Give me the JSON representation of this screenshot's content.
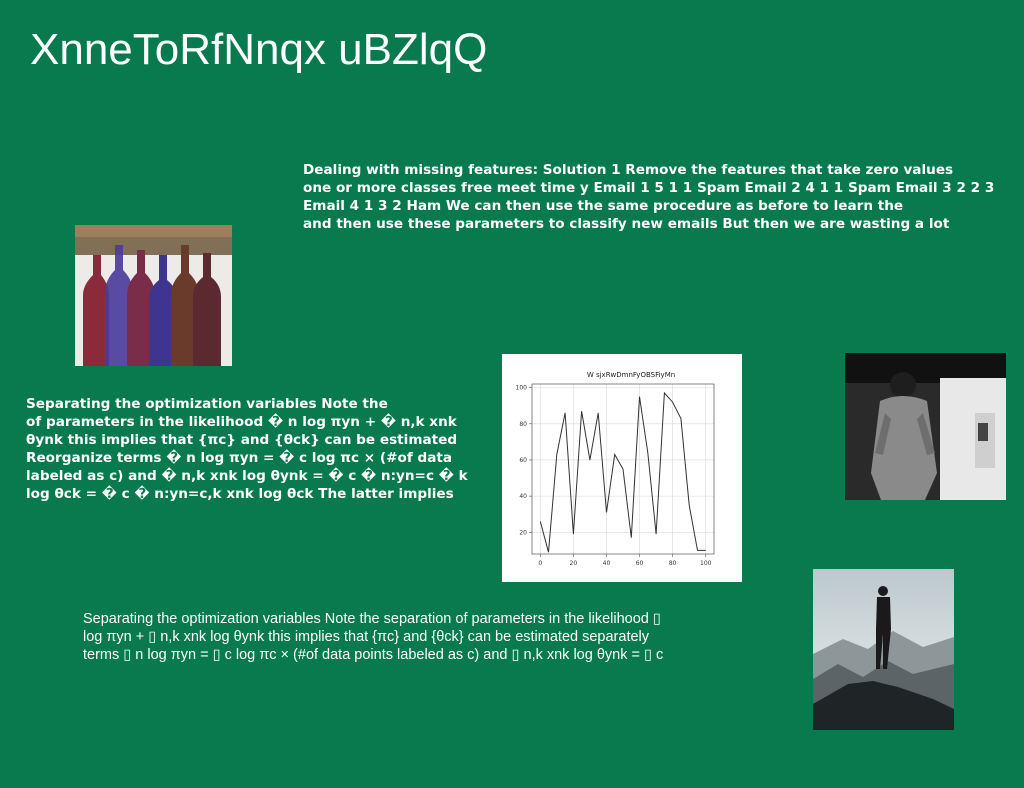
{
  "slide": {
    "title": "XnneToRfNnqx uBZlqQ",
    "text_block_1": [
      "Dealing with missing features: Solution 1 Remove the features that take zero values",
      "one or more classes free meet time y Email 1 5 1 1 Spam Email 2 4 1 1 Spam Email 3 2 2 3",
      "Email 4 1 3 2 Ham We can then use the same procedure as before to learn the",
      "and then use these parameters to classify new emails But then we are wasting a lot"
    ],
    "text_block_2": [
      "Separating the optimization variables Note the",
      "of parameters in the likelihood � n log πyn + � n,k xnk",
      "θynk this implies that {πc} and {θck} can be estimated",
      "Reorganize terms � n log πyn = � c log πc × (#of data",
      "labeled as c) and � n,k xnk log θynk = � c � n:yn=c � k",
      "log θck = � c � n:yn=c,k xnk log θck The latter implies"
    ],
    "text_block_3": [
      "Separating the optimization variables Note the separation of parameters in the likelihood ▯",
      "log πyn + ▯ n,k xnk log θynk this implies that {πc} and {θck} can be estimated separately",
      "terms ▯ n log πyn = ▯ c log πc × (#of data points labeled as c) and ▯ n,k xnk log θynk = ▯ c"
    ]
  },
  "colors": {
    "background": "#087a4e",
    "text": "#ffffff"
  },
  "chart_data": {
    "type": "line",
    "title": "W sjxRwDmnFyOBSFiyMn",
    "xlabel": "",
    "ylabel": "",
    "xlim": [
      -5,
      105
    ],
    "ylim": [
      8,
      102
    ],
    "x_ticks": [
      0,
      20,
      40,
      60,
      80,
      100
    ],
    "y_ticks": [
      20,
      40,
      60,
      80,
      100
    ],
    "grid": true,
    "series": [
      {
        "color": "#333333",
        "x": [
          0,
          5,
          10,
          15,
          20,
          25,
          30,
          35,
          40,
          45,
          50,
          55,
          60,
          65,
          70,
          75,
          80,
          85,
          90,
          95,
          100
        ],
        "y": [
          26,
          9,
          63,
          86,
          19,
          87,
          60,
          86,
          31,
          63,
          55,
          17,
          95,
          64,
          19,
          97,
          92,
          83,
          35,
          10,
          10
        ]
      }
    ]
  }
}
